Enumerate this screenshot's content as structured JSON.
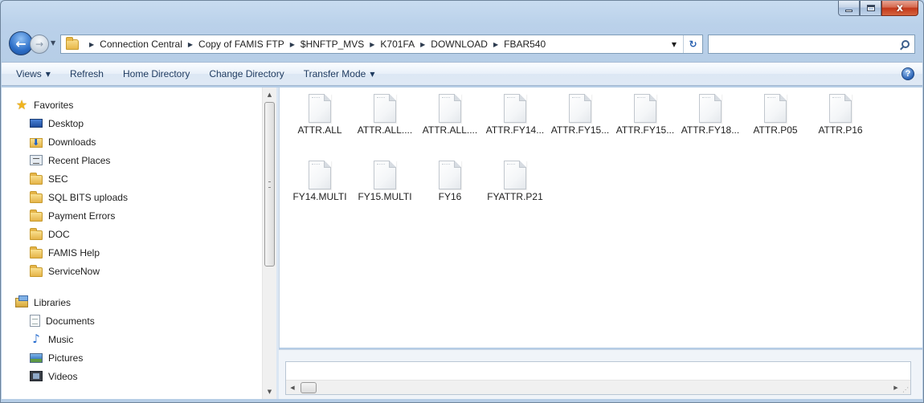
{
  "caption": {
    "minimize_glyph": "",
    "maximize_glyph": "",
    "close_glyph": "x"
  },
  "nav": {
    "back_glyph": "←",
    "forward_glyph": "→",
    "history_dropdown_glyph": "▼"
  },
  "address": {
    "crumbs": [
      "Connection Central",
      "Copy of FAMIS FTP",
      "$HNFTP_MVS",
      "K701FA",
      "DOWNLOAD",
      "FBAR540"
    ],
    "separator": "▶",
    "dropdown_glyph": "▼",
    "refresh_glyph": "↻"
  },
  "search": {
    "value": "",
    "placeholder": ""
  },
  "toolbar": {
    "views": "Views",
    "refresh": "Refresh",
    "home_directory": "Home Directory",
    "change_directory": "Change Directory",
    "transfer_mode": "Transfer Mode",
    "dropdown_glyph": "▼",
    "help_glyph": "?"
  },
  "tree": {
    "favorites": {
      "label": "Favorites",
      "items": [
        "Desktop",
        "Downloads",
        "Recent Places",
        "SEC",
        "SQL BITS uploads",
        "Payment Errors",
        "DOC",
        "FAMIS Help",
        "ServiceNow"
      ]
    },
    "libraries": {
      "label": "Libraries",
      "items": [
        "Documents",
        "Music",
        "Pictures",
        "Videos"
      ]
    }
  },
  "files": [
    "ATTR.ALL",
    "ATTR.ALL....",
    "ATTR.ALL....",
    "ATTR.FY14...",
    "ATTR.FY15...",
    "ATTR.FY15...",
    "ATTR.FY18...",
    "ATTR.P05",
    "ATTR.P16",
    "FY14.MULTI",
    "FY15.MULTI",
    "FY16",
    "FYATTR.P21"
  ],
  "scroll_glyphs": {
    "up": "▲",
    "down": "▼",
    "left": "◀",
    "right": "▶",
    "grip": "⋰"
  }
}
